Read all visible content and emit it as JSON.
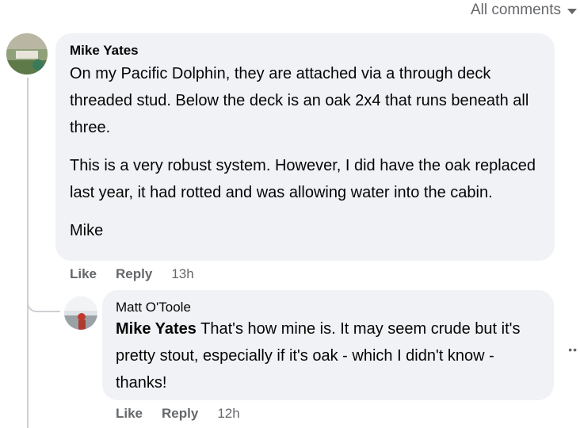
{
  "sort": {
    "label": "All comments"
  },
  "comments": [
    {
      "author": "Mike Yates",
      "paragraphs": [
        "On my Pacific Dolphin, they are attached via a through deck threaded stud. Below the deck is an oak 2x4 that runs beneath all three.",
        "This is a very robust system. However, I did have the oak replaced last year, it had rotted and was allowing water into the cabin.",
        "Mike"
      ],
      "like_label": "Like",
      "reply_label": "Reply",
      "time": "13h"
    }
  ],
  "reply": {
    "author": "Matt O'Toole",
    "mention": "Mike Yates",
    "text": " That's how mine is. It may seem crude but it's pretty stout, especially if it's oak - which I didn't know - thanks!",
    "like_label": "Like",
    "reply_label": "Reply",
    "time": "12h"
  },
  "more_label": "••"
}
